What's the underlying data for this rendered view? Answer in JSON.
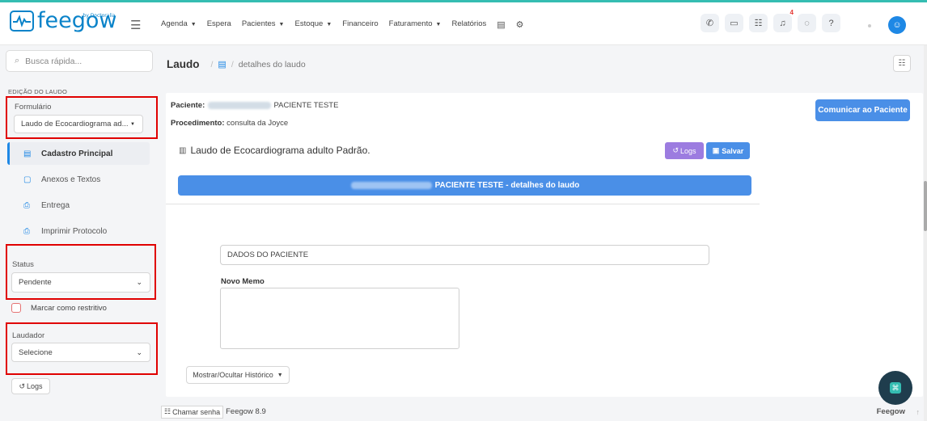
{
  "brand": {
    "logo_text": "feegow",
    "logo_tag": "by Doctoralia"
  },
  "nav": {
    "items": [
      {
        "label": "Agenda",
        "dropdown": true
      },
      {
        "label": "Espera",
        "dropdown": false
      },
      {
        "label": "Pacientes",
        "dropdown": true
      },
      {
        "label": "Estoque",
        "dropdown": true
      },
      {
        "label": "Financeiro",
        "dropdown": false
      },
      {
        "label": "Faturamento",
        "dropdown": true
      },
      {
        "label": "Relatórios",
        "dropdown": false
      }
    ],
    "notification_count": "4"
  },
  "sidebar": {
    "search_placeholder": "Busca rápida...",
    "section_title": "EDIÇÃO DO LAUDO",
    "formulario_label": "Formulário",
    "formulario_value": "Laudo de Ecocardiograma ad...",
    "menu": [
      {
        "label": "Cadastro Principal",
        "icon": "file-text-icon",
        "active": true
      },
      {
        "label": "Anexos e Textos",
        "icon": "file-icon",
        "active": false
      },
      {
        "label": "Entrega",
        "icon": "printer-icon",
        "active": false
      },
      {
        "label": "Imprimir Protocolo",
        "icon": "printer-icon",
        "active": false
      }
    ],
    "status_label": "Status",
    "status_value": "Pendente",
    "restrict_label": "Marcar como restritivo",
    "laudador_label": "Laudador",
    "laudador_value": "Selecione",
    "logs_label": "Logs"
  },
  "main": {
    "breadcrumb": {
      "title": "Laudo",
      "current": "detalhes do laudo"
    },
    "patient_label": "Paciente:",
    "patient_name": "PACIENTE TESTE",
    "procedure_label": "Procedimento:",
    "procedure_value": "consulta da Joyce",
    "comunicar_label": "Comunicar ao Paciente",
    "laudo_title": "Laudo de Ecocardiograma adulto Padrão.",
    "logs_label": "Logs",
    "salvar_label": "Salvar",
    "banner_text": "PACIENTE TESTE - detalhes do laudo",
    "dados_label": "DADOS DO PACIENTE",
    "memo_label": "Novo Memo",
    "historico_label": "Mostrar/Ocultar Histórico"
  },
  "footer": {
    "chamar_label": "Chamar senha",
    "version": "Feegow 8.9",
    "brand": "Feegow"
  },
  "colors": {
    "primary": "#4a8fe7",
    "accent_teal": "#35bdb2",
    "logs_purple": "#9c7ce0",
    "highlight_red": "#e00000"
  }
}
